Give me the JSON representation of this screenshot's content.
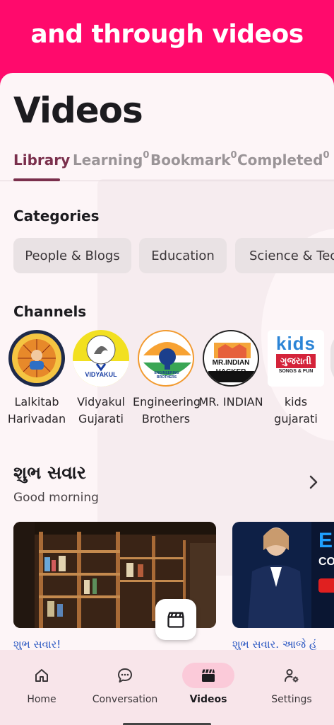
{
  "banner": {
    "title": "and through videos"
  },
  "page": {
    "title": "Videos"
  },
  "tabs": [
    {
      "label": "Library",
      "count": ""
    },
    {
      "label": "Learning",
      "count": "0"
    },
    {
      "label": "Bookmark",
      "count": "0"
    },
    {
      "label": "Completed",
      "count": "0"
    }
  ],
  "categories": {
    "title": "Categories",
    "items": [
      "People & Blogs",
      "Education",
      "Science & Tech"
    ]
  },
  "channels": {
    "title": "Channels",
    "items": [
      {
        "name": "Lalkitab Harivadan"
      },
      {
        "name": "Vidyakul Gujarati",
        "logo_text": "VIDYAKUL"
      },
      {
        "name": "Engineering Brothers",
        "logo_text": "ENGINEERING BROTHERS"
      },
      {
        "name": "MR. INDIAN",
        "logo_text": "MR.INDIAN HACKER"
      },
      {
        "name": "kids gujarati",
        "logo_text": "kids",
        "logo_sub": "ગુજરાતી",
        "logo_sub2": "SONGS & FUN"
      }
    ]
  },
  "section": {
    "title": "શુભ સવાર",
    "subtitle": "Good morning"
  },
  "videos": [
    {
      "caption": "શુભ સવાર!"
    },
    {
      "caption": "શુભ સવાર. આજે હં",
      "overlay_text": "E",
      "overlay_text2": "CO"
    }
  ],
  "nav": [
    {
      "label": "Home",
      "icon": "home-icon"
    },
    {
      "label": "Conversation",
      "icon": "chat-icon"
    },
    {
      "label": "Videos",
      "icon": "clapperboard-icon"
    },
    {
      "label": "Settings",
      "icon": "user-settings-icon"
    }
  ],
  "colors": {
    "banner": "#ff0a6c",
    "accent": "#7a2f4c",
    "nav_active": "#fbcad9"
  }
}
